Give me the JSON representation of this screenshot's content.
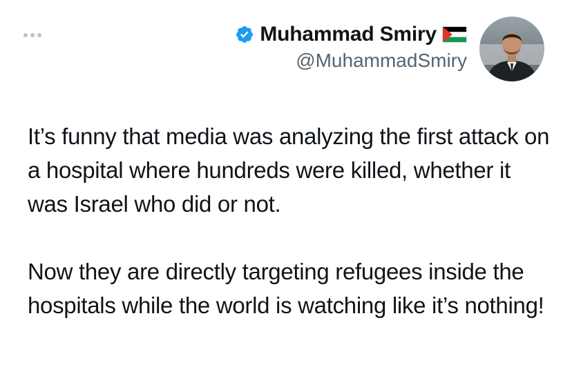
{
  "header": {
    "more_icon": "ellipsis-icon",
    "author": {
      "display_name": "Muhammad Smiry",
      "handle": "@MuhammadSmiry",
      "verified_icon": "verified-badge-icon",
      "flag_icon": "palestine-flag-icon",
      "avatar_icon": "avatar-photo"
    }
  },
  "tweet": {
    "paragraphs": [
      "It’s funny that media was analyzing the first attack on a hospital where hundreds were killed, whether it was Israel who did or not.",
      "Now they are directly targeting refugees inside the hospitals while the world is watching like it’s nothing!"
    ]
  },
  "colors": {
    "text": "#0f1419",
    "secondary_text": "#536471",
    "verified_blue": "#1d9bf0",
    "more_dots": "#b8c2cc"
  }
}
